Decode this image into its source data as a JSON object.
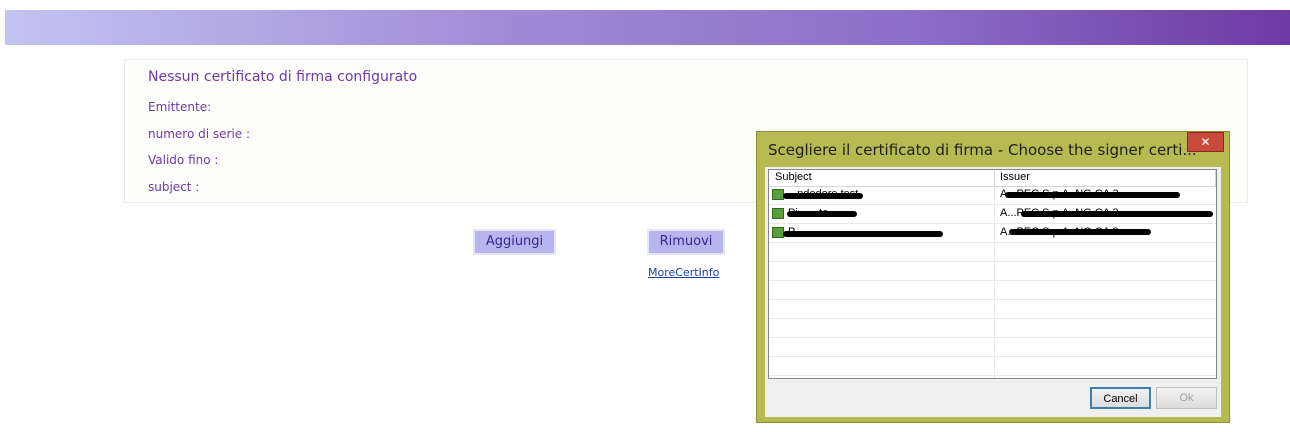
{
  "panel": {
    "title": "Nessun certificato di firma configurato",
    "emittente_label": "Emittente:",
    "serial_label": "numero di serie :",
    "valid_label": "Valido fino :",
    "subject_label": "subject :"
  },
  "buttons": {
    "add": "Aggiungi",
    "remove": "Rimuovi",
    "more_info": "MoreCertInfo"
  },
  "dialog": {
    "title": "Scegliere il certificato di firma - Choose the signer certi...",
    "close": "✕",
    "columns": [
      "Subject",
      "Issuer"
    ],
    "rows": [
      {
        "subject": "...ndedore test",
        "issuer": "A...PEC S.p.A. NG CA 3"
      },
      {
        "subject": "Pi... ...te",
        "issuer": "A...PEC S.p.A. NG CA 3"
      },
      {
        "subject": "P...",
        "issuer": "A...PEC S.p.A. NG CA 3"
      }
    ],
    "cancel": "Cancel",
    "ok": "Ok"
  },
  "colors": {
    "accent_purple": "#6e3aa2",
    "dialog_frame": "#b7ba50",
    "button_bg": "#b7b4ee"
  }
}
